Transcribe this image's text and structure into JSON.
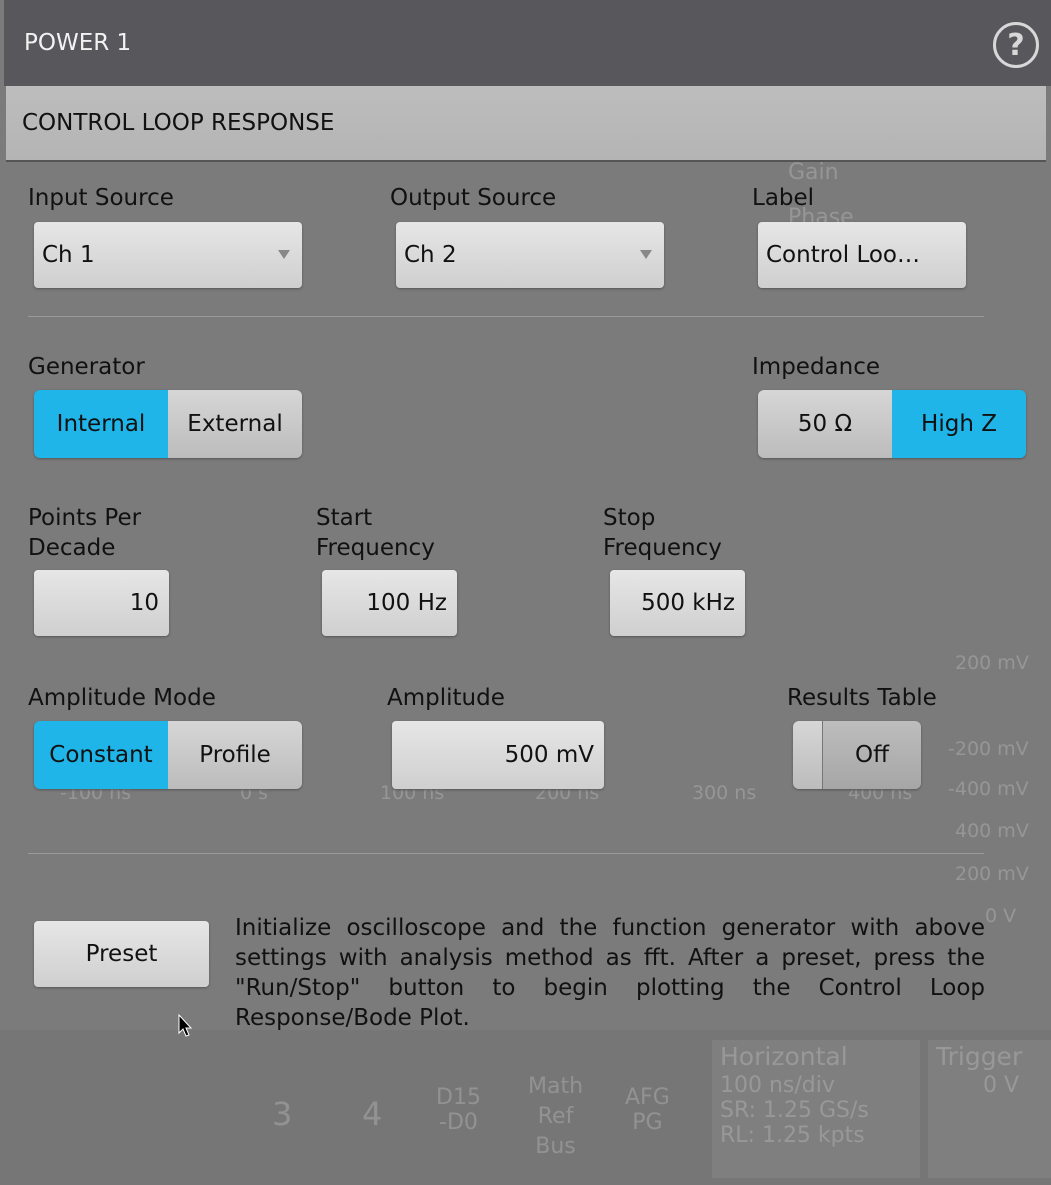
{
  "header": {
    "title": "POWER 1",
    "help_icon": "question-circle-icon"
  },
  "subheader": {
    "title": "CONTROL LOOP RESPONSE"
  },
  "input_source": {
    "label": "Input Source",
    "value": "Ch 1"
  },
  "output_source": {
    "label": "Output Source",
    "value": "Ch 2"
  },
  "label_field": {
    "label": "Label",
    "value": "Control Loo…"
  },
  "generator": {
    "label": "Generator",
    "options": [
      "Internal",
      "External"
    ],
    "selected": "Internal"
  },
  "impedance": {
    "label": "Impedance",
    "options": [
      "50 Ω",
      "High Z"
    ],
    "selected": "High Z"
  },
  "points_per_decade": {
    "label_line1": "Points Per",
    "label_line2": "Decade",
    "value": "10"
  },
  "start_frequency": {
    "label_line1": "Start",
    "label_line2": "Frequency",
    "value": "100 Hz"
  },
  "stop_frequency": {
    "label_line1": "Stop",
    "label_line2": "Frequency",
    "value": "500 kHz"
  },
  "amplitude_mode": {
    "label": "Amplitude Mode",
    "options": [
      "Constant",
      "Profile"
    ],
    "selected": "Constant"
  },
  "amplitude": {
    "label": "Amplitude",
    "value": "500 mV"
  },
  "results_table": {
    "label": "Results Table",
    "value": "Off"
  },
  "preset": {
    "label": "Preset",
    "description": "Initialize oscilloscope and the function generator with above settings with analysis method as fft. After a preset, press the \"Run/Stop\" button to begin plotting the Control Loop Response/Bode Plot."
  },
  "background": {
    "legend": [
      "Gain",
      "Phase"
    ],
    "y_ticks": [
      "400 mV",
      "200 mV",
      "-200 mV",
      "-400 mV",
      "400 mV",
      "200 mV",
      "0 V"
    ],
    "x_ticks": [
      "-100 ns",
      "0 s",
      "100 ns",
      "200 ns",
      "300 ns",
      "400 ns"
    ],
    "buttons": [
      "3",
      "4",
      "D15\n-D0",
      "Math\nRef\nBus",
      "AFG\nPG"
    ],
    "horizontal": {
      "title": "Horizontal",
      "scale": "100 ns/div",
      "sr": "SR: 1.25 GS/s",
      "rl": "RL: 1.25 kpts"
    },
    "trigger": {
      "title": "Trigger",
      "level": "0 V"
    }
  },
  "colors": {
    "accent": "#1fb5e8",
    "header": "#58585c",
    "panel": "#7b7b7b"
  }
}
